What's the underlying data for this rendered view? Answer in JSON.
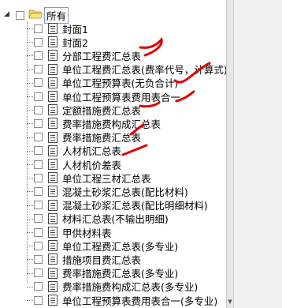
{
  "tree": {
    "root_label": "所有",
    "items": [
      {
        "label": "封面1"
      },
      {
        "label": "封面2"
      },
      {
        "label": "分部工程费汇总表"
      },
      {
        "label": "单位工程费汇总表(费率代号，计算式)"
      },
      {
        "label": "单位工程预算表(无负合计)"
      },
      {
        "label": "单位工程预算表费用表合一"
      },
      {
        "label": "定额措施费汇总表"
      },
      {
        "label": "费率措施费构成汇总表"
      },
      {
        "label": "费率措施费汇总表"
      },
      {
        "label": "人材机汇总表"
      },
      {
        "label": "人材机价差表"
      },
      {
        "label": "单位工程三材汇总表"
      },
      {
        "label": "混凝土砂浆汇总表(配比材料)"
      },
      {
        "label": "混凝土砂浆汇总表(配比明细材料)"
      },
      {
        "label": "材料汇总表(不输出明细)"
      },
      {
        "label": "甲供材料表"
      },
      {
        "label": "单位工程费汇总表(多专业)"
      },
      {
        "label": "措施项目费汇总表"
      },
      {
        "label": "费率措施费汇总表(多专业)"
      },
      {
        "label": "费率措施费构成汇总表(多专业)"
      },
      {
        "label": "单位工程预算表费用表合一(多专业)"
      }
    ]
  },
  "annotation_color": "#e00000"
}
